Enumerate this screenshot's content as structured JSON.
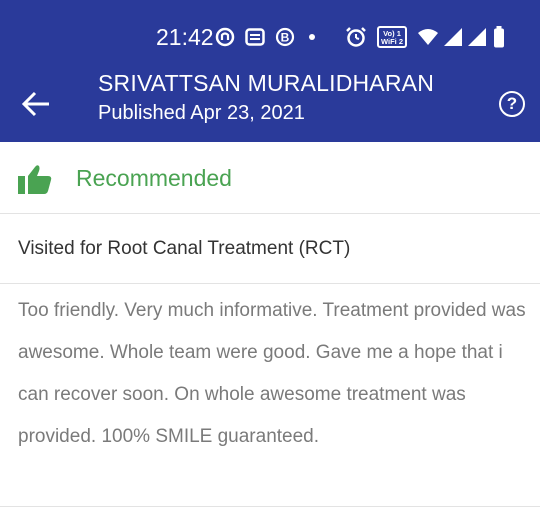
{
  "status_bar": {
    "time": "21:42",
    "icons": [
      "app-circle-icon",
      "message-icon",
      "b-circle-icon",
      "dot-icon",
      "alarm-icon",
      "vowifi-icon",
      "wifi-icon",
      "signal-icon",
      "signal-icon",
      "battery-icon"
    ],
    "vowifi_label": "Vo) WiFi 2"
  },
  "header": {
    "name": "SRIVATTSAN MURALIDHARAN",
    "published": "Published Apr 23, 2021",
    "help_symbol": "?"
  },
  "recommendation": {
    "label": "Recommended",
    "color": "#4aa352"
  },
  "visit": {
    "text": "Visited for Root Canal Treatment (RCT)"
  },
  "review": {
    "text": "Too friendly. Very much informative. Treatment provided was awesome. Whole team were good. Gave me a hope that i can recover soon. On whole awesome treatment was provided. 100% SMILE guaranteed."
  },
  "colors": {
    "header_bg": "#2a3a9a",
    "text_primary": "#333333",
    "text_secondary": "#7a7a7a"
  }
}
